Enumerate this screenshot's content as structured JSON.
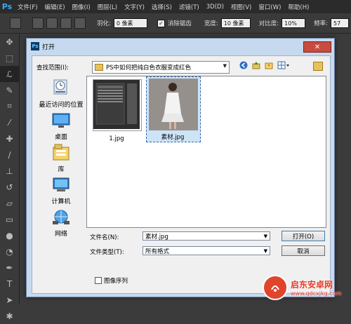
{
  "app": {
    "logo": "Ps"
  },
  "menubar": {
    "items": [
      "文件(F)",
      "编辑(E)",
      "图像(I)",
      "图层(L)",
      "文字(Y)",
      "选择(S)",
      "滤镜(T)",
      "3D(D)",
      "视图(V)",
      "窗口(W)",
      "帮助(H)"
    ]
  },
  "optionsbar": {
    "feather_label": "羽化:",
    "feather_value": "0 像素",
    "antialias_label": "消除锯齿",
    "antialias_checked": true,
    "width_label": "宽度:",
    "width_value": "10 像素",
    "contrast_label": "对比度:",
    "contrast_value": "10%",
    "frequency_label": "频率:",
    "frequency_value": "57"
  },
  "dialog": {
    "title": "打开",
    "close_symbol": "✕",
    "lookin_label": "查找范围(I):",
    "lookin_value": "PS中如何把纯白色衣服变成红色",
    "places": [
      {
        "label": "最近访问的位置",
        "icon": "recent-places-icon"
      },
      {
        "label": "桌面",
        "icon": "desktop-icon"
      },
      {
        "label": "库",
        "icon": "libraries-icon"
      },
      {
        "label": "计算机",
        "icon": "computer-icon"
      },
      {
        "label": "网络",
        "icon": "network-icon"
      }
    ],
    "files": [
      {
        "name": "1.jpg",
        "selected": false
      },
      {
        "name": "素材.jpg",
        "selected": true
      }
    ],
    "filename_label": "文件名(N):",
    "filename_value": "素材.jpg",
    "filetype_label": "文件类型(T):",
    "filetype_value": "所有格式",
    "open_button": "打开(O)",
    "cancel_button": "取消",
    "image_sequence_label": "图像序列"
  },
  "watermark": {
    "name": "启东安卓网",
    "url": "www.qdcxjkg.com"
  }
}
